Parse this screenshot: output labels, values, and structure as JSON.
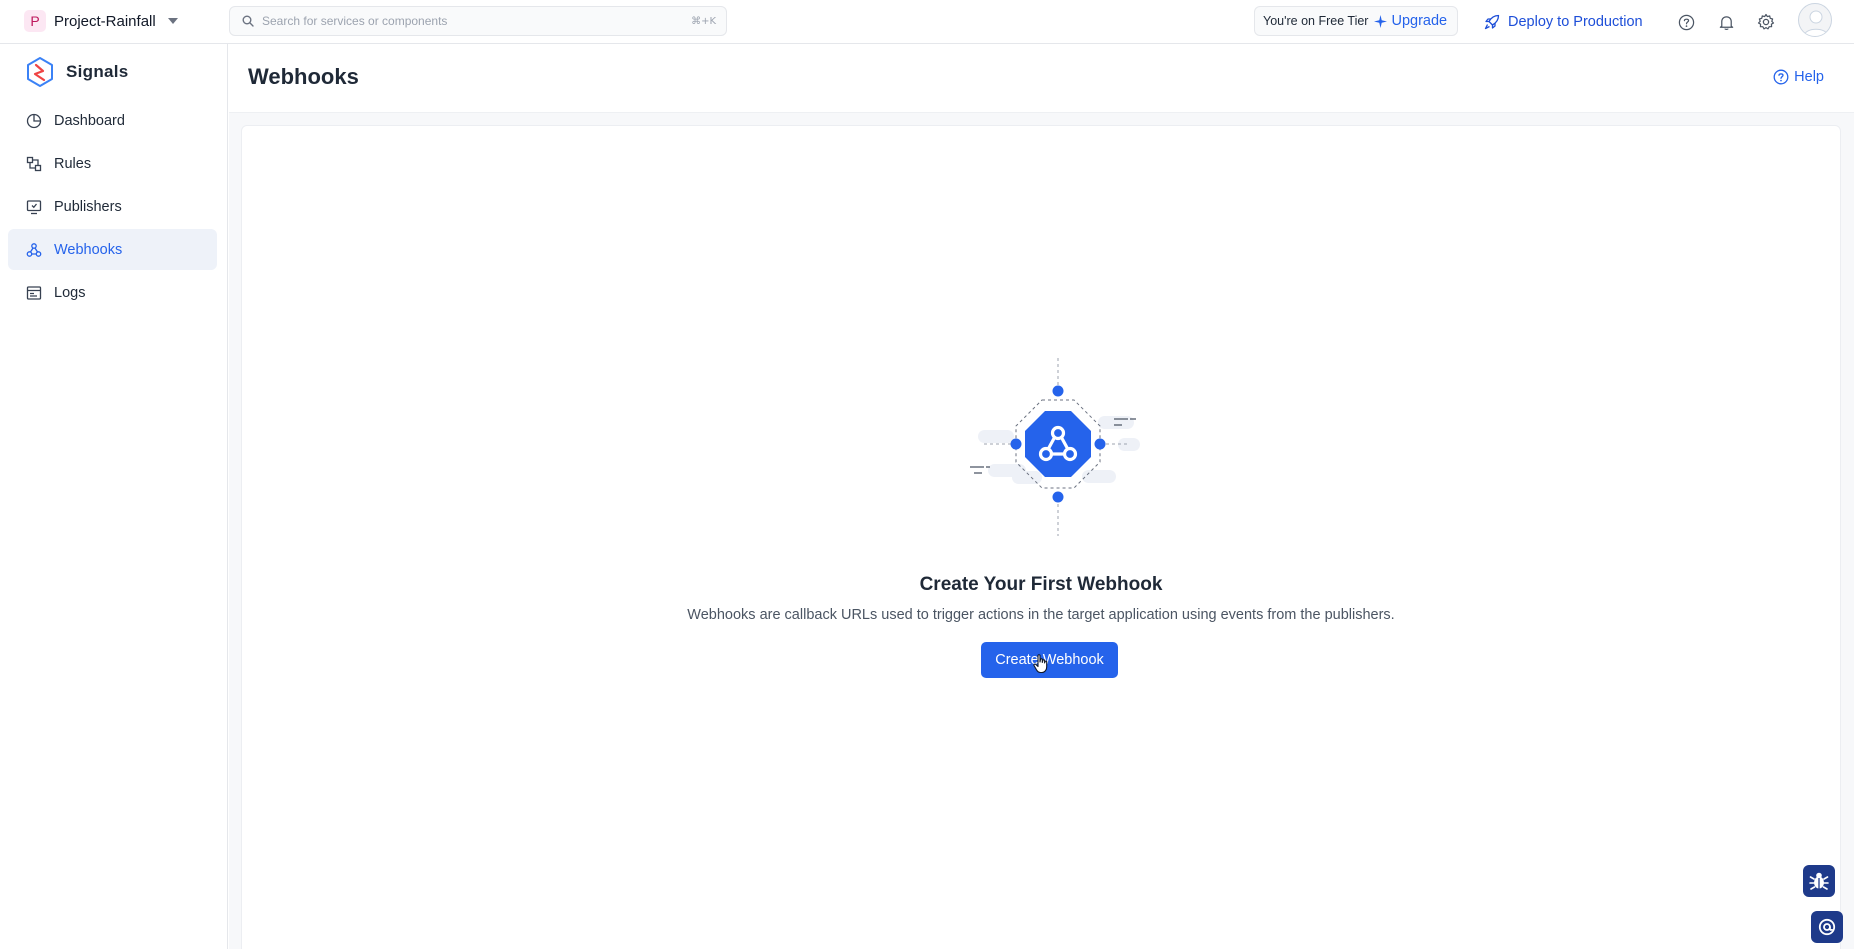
{
  "topbar": {
    "project_initial": "P",
    "project_name": "Project-Rainfall",
    "search_placeholder": "Search for services or components",
    "search_shortcut": "⌘+K",
    "tier_text": "You're on Free Tier",
    "upgrade_label": "Upgrade",
    "deploy_label": "Deploy to Production"
  },
  "sidebar": {
    "brand": "Signals",
    "items": [
      {
        "label": "Dashboard",
        "icon": "dashboard-icon",
        "active": false
      },
      {
        "label": "Rules",
        "icon": "rules-icon",
        "active": false
      },
      {
        "label": "Publishers",
        "icon": "publishers-icon",
        "active": false
      },
      {
        "label": "Webhooks",
        "icon": "webhook-icon",
        "active": true
      },
      {
        "label": "Logs",
        "icon": "logs-icon",
        "active": false
      }
    ]
  },
  "page": {
    "title": "Webhooks",
    "help_label": "Help"
  },
  "empty_state": {
    "title": "Create Your First Webhook",
    "description": "Webhooks are callback URLs used to trigger actions in the target application using events from the publishers.",
    "button_label": "Create Webhook"
  },
  "colors": {
    "accent": "#2563eb",
    "active_bg": "#eef2f9",
    "fab": "#1e3a8a"
  }
}
